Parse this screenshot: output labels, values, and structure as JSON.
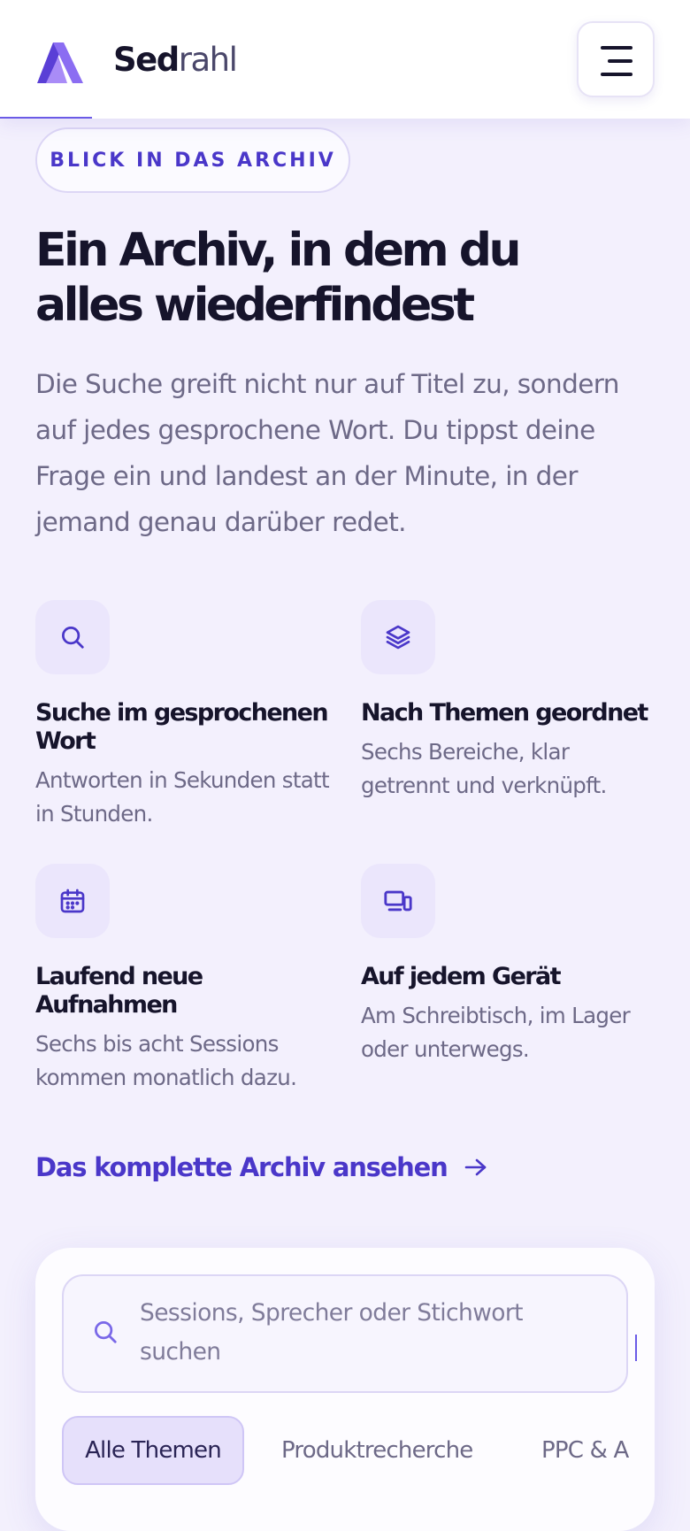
{
  "header": {
    "brand_bold": "Sed",
    "brand_light": "rahl",
    "menu_icon": "hamburger-icon"
  },
  "hero": {
    "eyebrow": "BLICK IN DAS ARCHIV",
    "title_line1": "Ein Archiv, in dem du",
    "title_line2": "alles wiederfindest",
    "lead": "Die Suche greift nicht nur auf Titel zu, sondern auf jedes gesprochene Wort. Du tippst deine Frage ein und landest an der Minute, in der jemand genau darüber redet."
  },
  "features": [
    {
      "icon": "search-icon",
      "title": "Suche im gesprochenen Wort",
      "desc": "Antworten in Sekunden statt in Stunden."
    },
    {
      "icon": "layers-icon",
      "title": "Nach Themen geordnet",
      "desc": "Sechs Bereiche, klar getrennt und verknüpft."
    },
    {
      "icon": "calendar-icon",
      "title": "Laufend neue Aufnahmen",
      "desc": "Sechs bis acht Sessions kommen monatlich dazu."
    },
    {
      "icon": "devices-icon",
      "title": "Auf jedem Gerät",
      "desc": "Am Schreibtisch, im Lager oder unterwegs."
    }
  ],
  "cta": {
    "label": "Das komplette Archiv ansehen",
    "icon": "arrow-right-icon"
  },
  "archive": {
    "search_placeholder": "Sessions, Sprecher oder Stichwort suchen",
    "chips": [
      "Alle Themen",
      "Produktrecherche",
      "PPC & A"
    ]
  },
  "colors": {
    "accent": "#4a37c9",
    "background": "#f3f0fd",
    "text": "#16142b",
    "muted": "#6d6987"
  }
}
